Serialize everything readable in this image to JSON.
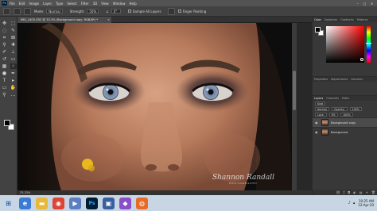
{
  "app": {
    "logo": "Ps",
    "menu": [
      "File",
      "Edit",
      "Image",
      "Layer",
      "Type",
      "Select",
      "Filter",
      "3D",
      "View",
      "Window",
      "Help"
    ],
    "window_controls": [
      "–",
      "▢",
      "✕"
    ]
  },
  "options": {
    "mode_label": "Mode:",
    "mode_value": "Normal",
    "strength_label": "Strength:",
    "strength_value": "50%",
    "angle_value": "0°",
    "sample_all_layers": "Sample All Layers",
    "finger_painting": "Finger Painting"
  },
  "document": {
    "tab_title": "IMG_1405.CR2 @ 33.3% (Background copy, RGB/8*) *",
    "zoom_status": "33.33%"
  },
  "watermark": {
    "signature": "Shannon Randall",
    "subtitle": "PHOTOGRAPHY"
  },
  "color_panel": {
    "tabs": [
      "Color",
      "Swatches",
      "Gradients",
      "Patterns"
    ],
    "active_tab": "Color"
  },
  "properties_panel": {
    "tabs": [
      "Properties",
      "Adjustments",
      "Libraries"
    ]
  },
  "layers_panel": {
    "tabs": [
      "Layers",
      "Channels",
      "Paths"
    ],
    "kind_label": "Kind",
    "blend_mode": "Normal",
    "opacity_label": "Opacity:",
    "opacity_value": "100%",
    "lock_label": "Lock:",
    "fill_label": "Fill:",
    "fill_value": "100%",
    "layers": [
      {
        "name": "Background copy",
        "active": true
      },
      {
        "name": "Background",
        "active": false
      }
    ]
  },
  "taskbar": {
    "time": "10:25 AM",
    "date": "12-Apr-20"
  },
  "colors": {
    "accent": "#31a8ff",
    "ui_dark": "#282828",
    "ui_panel": "#383838",
    "taskbar": "#c8d6e3"
  }
}
